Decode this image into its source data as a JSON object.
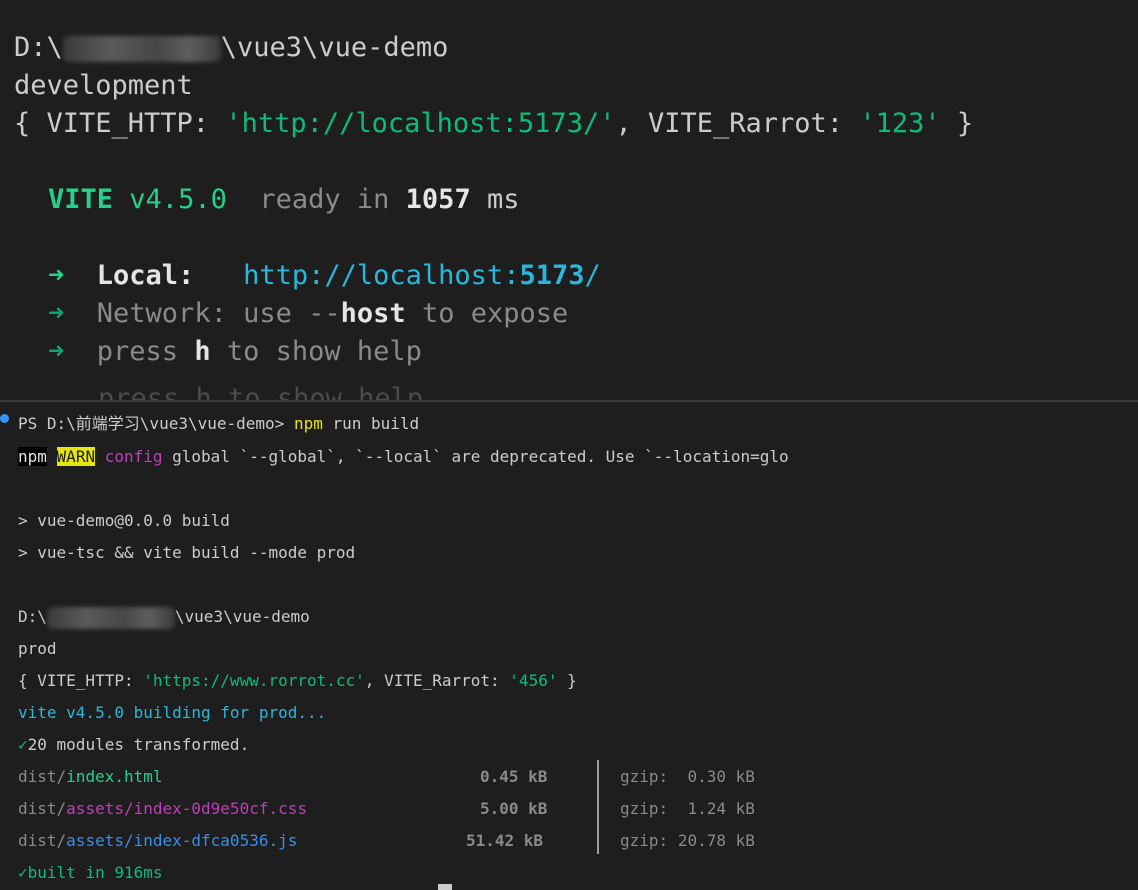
{
  "top": {
    "path_prefix": "D:\\",
    "path_suffix": "\\vue3\\vue-demo",
    "mode": "development",
    "env_open": "{ VITE_HTTP: ",
    "env_http": "'http://localhost:5173/'",
    "env_mid": ", VITE_Rarrot: ",
    "env_rarrot": "'123'",
    "env_close": " }",
    "vite_name": "VITE",
    "vite_version": "v4.5.0",
    "ready_in": "ready in",
    "ready_ms": "1057",
    "ms_unit": "ms",
    "arrow": "➜",
    "local_label": "Local:",
    "local_url_pre": "http://localhost:",
    "local_port": "5173",
    "local_url_post": "/",
    "network_label": "Network:",
    "network_use": "use",
    "network_flag": "--",
    "network_host": "host",
    "network_expose": "to expose",
    "press": "press",
    "press_key": "h",
    "press_help": "to show help"
  },
  "bottom": {
    "prompt": "PS D:\\前端学习\\vue3\\vue-demo> ",
    "cmd_npm": "npm",
    "cmd_rest": " run build",
    "npm_badge": "npm",
    "warn_badge": "WARN",
    "warn_config": "config",
    "warn_msg": " global `--global`, `--local` are deprecated. Use `--location=glo",
    "script_1": "> vue-demo@0.0.0 build",
    "script_2": "> vue-tsc && vite build --mode prod",
    "path_prefix": "D:\\",
    "path_suffix": "\\vue3\\vue-demo",
    "mode": "prod",
    "env_open": "{ VITE_HTTP: ",
    "env_http": "'https://www.rorrot.cc'",
    "env_mid": ", VITE_Rarrot: ",
    "env_rarrot": "'456'",
    "env_close": " }",
    "building": "vite v4.5.0 building for prod...",
    "check": "✓",
    "transformed": "20 modules transformed.",
    "built": "built in 916ms",
    "files": [
      {
        "dir": "dist/",
        "name": "index.html",
        "color": "#23d18b",
        "size": "0.45 kB",
        "gzip_label": "gzip:",
        "gzip": " 0.30 kB"
      },
      {
        "dir": "dist/",
        "name": "assets/index-0d9e50cf.css",
        "color": "#bc3fbc",
        "size": "5.00 kB",
        "gzip_label": "gzip:",
        "gzip": " 1.24 kB"
      },
      {
        "dir": "dist/",
        "name": "assets/index-dfca0536.js",
        "color": "#3b8eea",
        "size": "51.42 kB",
        "gzip_label": "gzip:",
        "gzip": "20.78 kB"
      }
    ]
  }
}
